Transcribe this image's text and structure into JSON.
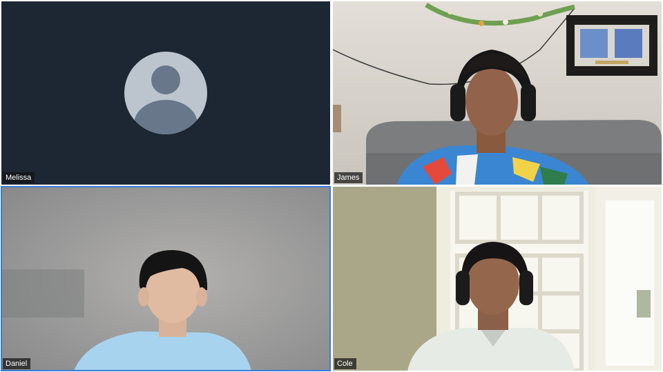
{
  "participants": [
    {
      "name": "Melissa",
      "video": false,
      "avatar_icon": "person-placeholder-icon"
    },
    {
      "name": "James",
      "video": true
    },
    {
      "name": "Daniel",
      "video": true,
      "active_speaker": true
    },
    {
      "name": "Cole",
      "video": true
    }
  ],
  "colors": {
    "tile_background": "#1c2733",
    "avatar_circle": "#bcc5ce",
    "avatar_figure": "#69778a",
    "active_speaker_border": "#3a7bd5",
    "name_tag_background": "rgba(20,20,20,0.72)"
  }
}
